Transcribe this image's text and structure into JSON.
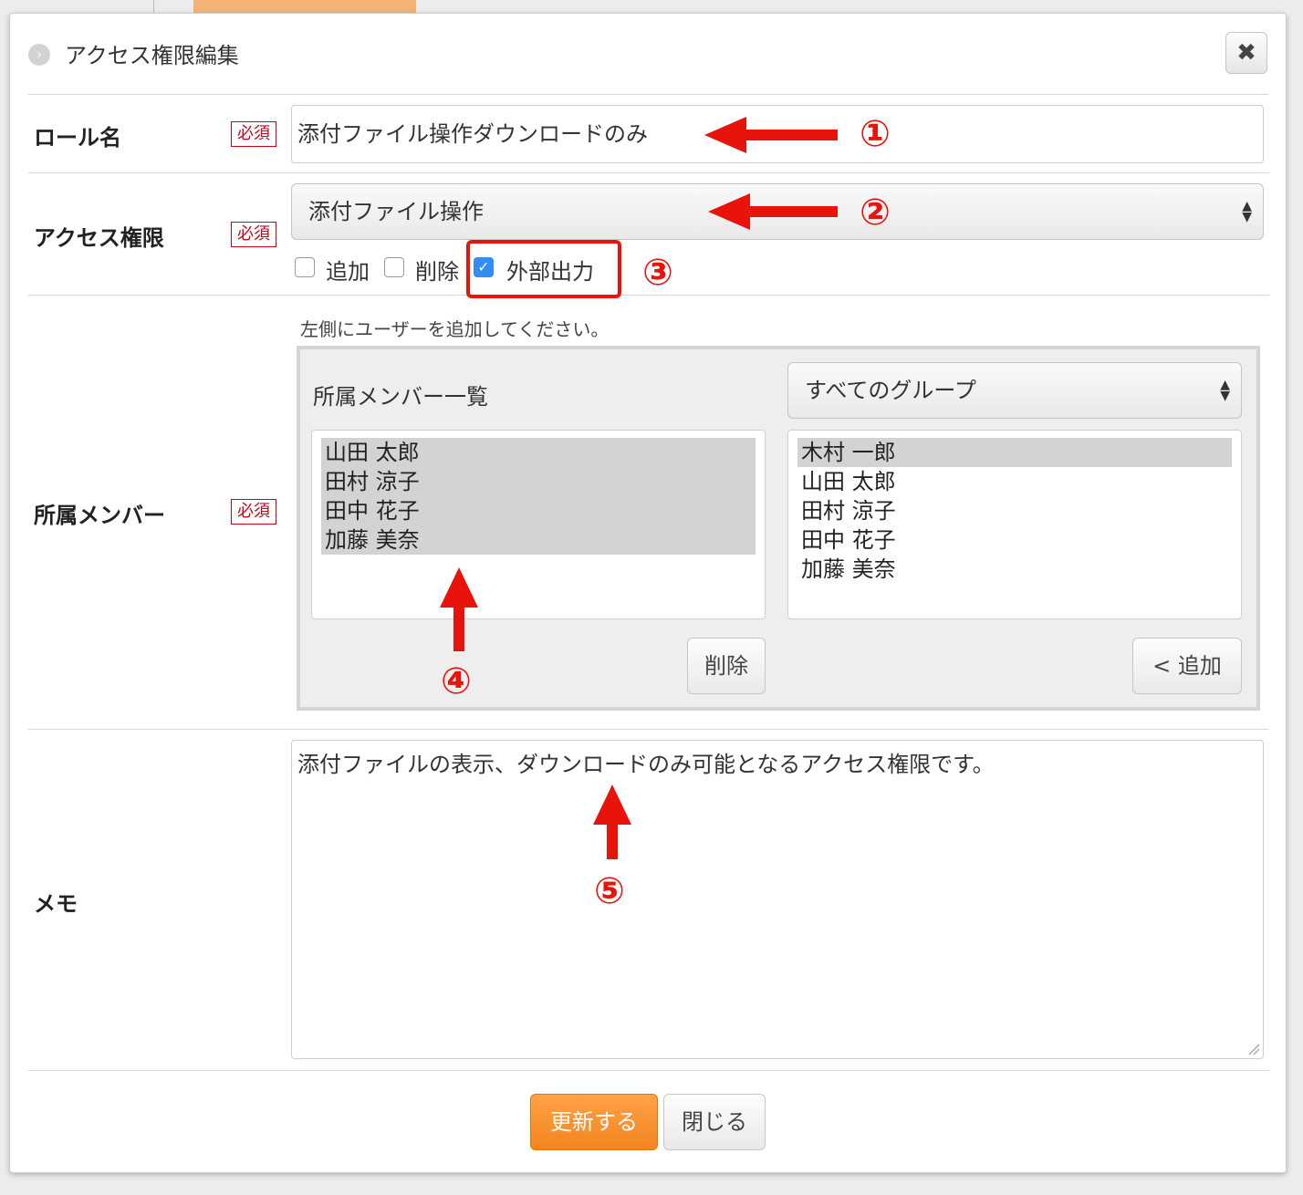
{
  "dialog": {
    "title": "アクセス権限編集",
    "close_symbol": "✖"
  },
  "role_name": {
    "label": "ロール名",
    "required": "必須",
    "value": "添付ファイル操作ダウンロードのみ"
  },
  "access": {
    "label": "アクセス権限",
    "required": "必須",
    "selected": "添付ファイル操作",
    "checkboxes": [
      {
        "label": "追加",
        "checked": false
      },
      {
        "label": "削除",
        "checked": false
      },
      {
        "label": "外部出力",
        "checked": true
      }
    ]
  },
  "members": {
    "label": "所属メンバー",
    "required": "必須",
    "hint": "左側にユーザーを追加してください。",
    "panel_title": "所属メンバー一覧",
    "group_select": "すべてのグループ",
    "assigned": [
      "山田 太郎",
      "田村 涼子",
      "田中 花子",
      "加藤 美奈"
    ],
    "available": [
      "木村 一郎",
      "山田 太郎",
      "田村 涼子",
      "田中 花子",
      "加藤 美奈"
    ],
    "remove_button": "削除",
    "add_button": "< 追加"
  },
  "memo": {
    "label": "メモ",
    "value": "添付ファイルの表示、ダウンロードのみ可能となるアクセス権限です。"
  },
  "footer": {
    "update_button": "更新する",
    "close_button": "閉じる"
  },
  "annotations": [
    "①",
    "②",
    "③",
    "④",
    "⑤"
  ],
  "colors": {
    "annotation_red": "#e8140b",
    "primary_orange": "#f2851f",
    "checkbox_blue": "#2f8ef5"
  }
}
